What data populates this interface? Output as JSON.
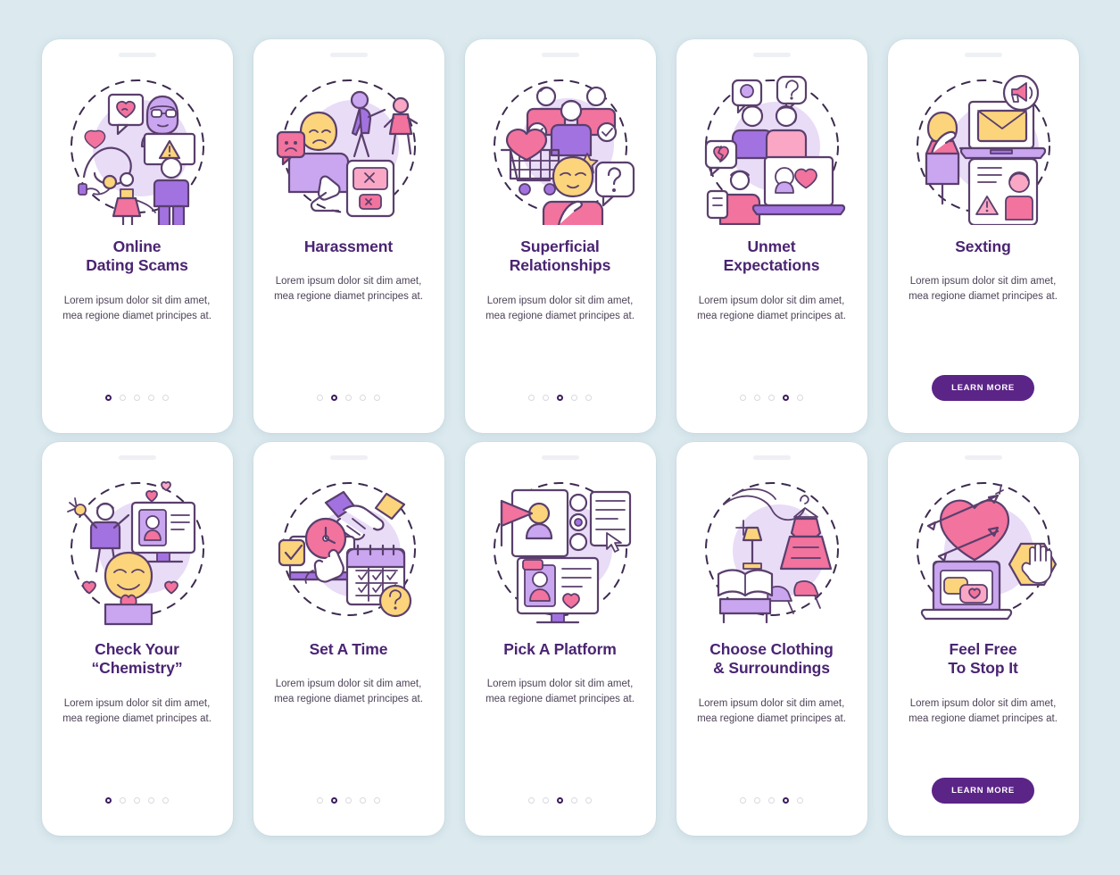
{
  "meta": {
    "background_color": "#dceaef",
    "card_color": "#ffffff",
    "title_color": "#4a2472",
    "accent_color": "#5b2487",
    "dot_active_color": "#3b1c5e",
    "dot_inactive_color": "#d9d9e0"
  },
  "shared": {
    "description": "Lorem ipsum dolor sit dim amet, mea regione diamet principes at.",
    "learn_more_label": "LEARN MORE",
    "dots_total": 5
  },
  "screens": [
    {
      "id": "online-dating-scams",
      "title": "Online\nDating Scams",
      "title_lines": [
        "Online",
        "Dating Scams"
      ],
      "description": "Lorem ipsum dolor sit dim amet, mea regione diamet principes at.",
      "footer_type": "dots",
      "active_dot": 1,
      "illustration": "online-dating-scams-illustration"
    },
    {
      "id": "harassment",
      "title": "Harassment",
      "title_lines": [
        "Harassment"
      ],
      "description": "Lorem ipsum dolor sit dim amet, mea regione diamet principes at.",
      "footer_type": "dots",
      "active_dot": 2,
      "illustration": "harassment-illustration"
    },
    {
      "id": "superficial-relationships",
      "title": "Superficial\nRelationships",
      "title_lines": [
        "Superficial",
        "Relationships"
      ],
      "description": "Lorem ipsum dolor sit dim amet, mea regione diamet principes at.",
      "footer_type": "dots",
      "active_dot": 3,
      "illustration": "superficial-relationships-illustration"
    },
    {
      "id": "unmet-expectations",
      "title": "Unmet\nExpectations",
      "title_lines": [
        "Unmet",
        "Expectations"
      ],
      "description": "Lorem ipsum dolor sit dim amet, mea regione diamet principes at.",
      "footer_type": "dots",
      "active_dot": 4,
      "illustration": "unmet-expectations-illustration"
    },
    {
      "id": "sexting",
      "title": "Sexting",
      "title_lines": [
        "Sexting"
      ],
      "description": "Lorem ipsum dolor sit dim amet, mea regione diamet principes at.",
      "footer_type": "button",
      "button_label": "LEARN MORE",
      "illustration": "sexting-illustration"
    },
    {
      "id": "check-your-chemistry",
      "title": "Check Your\n“Chemistry”",
      "title_lines": [
        "Check Your",
        "“Chemistry”"
      ],
      "description": "Lorem ipsum dolor sit dim amet, mea regione diamet principes at.",
      "footer_type": "dots",
      "active_dot": 1,
      "illustration": "check-your-chemistry-illustration"
    },
    {
      "id": "set-a-time",
      "title": "Set A Time",
      "title_lines": [
        "Set A Time"
      ],
      "description": "Lorem ipsum dolor sit dim amet, mea regione diamet principes at.",
      "footer_type": "dots",
      "active_dot": 2,
      "illustration": "set-a-time-illustration"
    },
    {
      "id": "pick-a-platform",
      "title": "Pick A Platform",
      "title_lines": [
        "Pick A Platform"
      ],
      "description": "Lorem ipsum dolor sit dim amet, mea regione diamet principes at.",
      "footer_type": "dots",
      "active_dot": 3,
      "illustration": "pick-a-platform-illustration"
    },
    {
      "id": "choose-clothing-surroundings",
      "title": "Choose Clothing\n& Surroundings",
      "title_lines": [
        "Choose Clothing",
        "& Surroundings"
      ],
      "description": "Lorem ipsum dolor sit dim amet, mea regione diamet principes at.",
      "footer_type": "dots",
      "active_dot": 4,
      "illustration": "choose-clothing-illustration"
    },
    {
      "id": "feel-free-to-stop-it",
      "title": "Feel Free\nTo Stop It",
      "title_lines": [
        "Feel Free",
        "To Stop It"
      ],
      "description": "Lorem ipsum dolor sit dim amet, mea regione diamet principes at.",
      "footer_type": "button",
      "button_label": "LEARN MORE",
      "illustration": "feel-free-to-stop-it-illustration"
    }
  ]
}
